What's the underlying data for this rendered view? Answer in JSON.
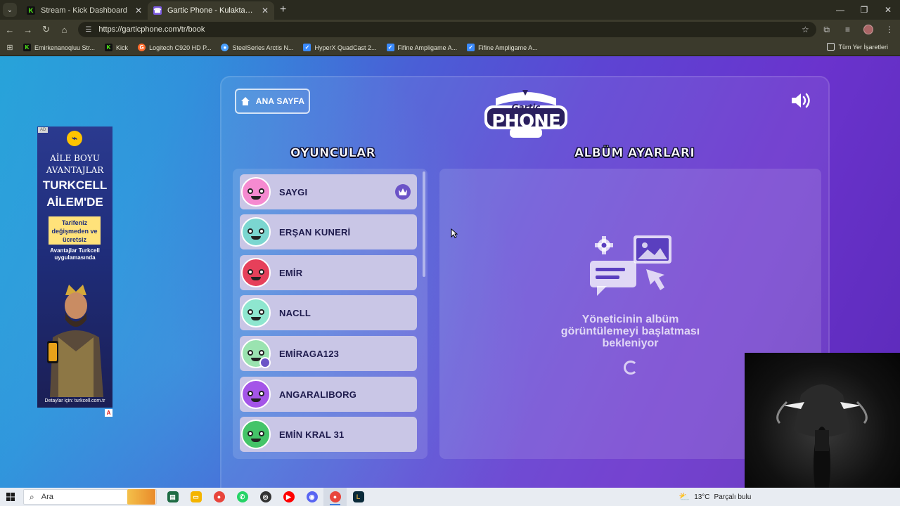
{
  "browser": {
    "tabs": [
      {
        "title": "Stream - Kick Dashboard",
        "favicon": "kick-icon",
        "color": "#53fc18",
        "active": false
      },
      {
        "title": "Gartic Phone - Kulaktan Kulağa",
        "favicon": "gartic-icon",
        "color": "#7b5ae0",
        "active": true
      }
    ],
    "url": "https://garticphone.com/tr/book",
    "bookmarks": [
      {
        "label": "Emirkenanoqluu Str...",
        "icon": "kick-icon",
        "color": "#53fc18"
      },
      {
        "label": "Kick",
        "icon": "kick-icon",
        "color": "#53fc18"
      },
      {
        "label": "Logitech C920 HD P...",
        "icon": "logitech-icon",
        "color": "#ff6b2b"
      },
      {
        "label": "SteelSeries Arctis N...",
        "icon": "steelseries-icon",
        "color": "#4aa0ff"
      },
      {
        "label": "HyperX QuadCast 2...",
        "icon": "hyperx-icon",
        "color": "#3a8bff"
      },
      {
        "label": "Fifine Ampligame A...",
        "icon": "fifine-icon",
        "color": "#3a8bff"
      },
      {
        "label": "Fifine Ampligame A...",
        "icon": "fifine-icon",
        "color": "#3a8bff"
      }
    ],
    "all_bookmarks": "Tüm Yer İşaretleri"
  },
  "ad": {
    "tag": "AD",
    "line1": "AİLE BOYU",
    "line2": "AVANTAJLAR",
    "big1": "TURKCELL",
    "big2": "AİLEM'DE",
    "box": "Tarifeniz değişmeden ve ücretsiz",
    "small": "Avantajlar Turkcell uygulamasında",
    "footer": "Detaylar için: turkcell.com.tr",
    "brand_color": "#ffc400"
  },
  "game": {
    "home_button": "ANA SAYFA",
    "logo_top": "Gartic",
    "logo_main": "PHONE",
    "players_title": "OYUNCULAR",
    "album_title": "ALBÜM AYARLARI",
    "players": [
      {
        "name": "SAYGI",
        "avatar": "pink-monster-avatar",
        "color": "#f58ad0",
        "host": true
      },
      {
        "name": "ERŞAN KUNERİ",
        "avatar": "skull-face-avatar",
        "color": "#7bd6d0",
        "host": false
      },
      {
        "name": "EMİR",
        "avatar": "red-demon-avatar",
        "color": "#e6405a",
        "host": false
      },
      {
        "name": "NACLL",
        "avatar": "mint-ghost-avatar",
        "color": "#8ee6cf",
        "host": false
      },
      {
        "name": "EMİRAGA123",
        "avatar": "panda-avatar",
        "color": "#9ae3b0",
        "host": false
      },
      {
        "name": "ANGARALIBORG",
        "avatar": "purple-ghost-avatar",
        "color": "#a455e8",
        "host": false
      },
      {
        "name": "EMİN KRAL 31",
        "avatar": "green-goblin-avatar",
        "color": "#44c468",
        "host": false
      }
    ],
    "waiting_text_1": "Yöneticinin albüm",
    "waiting_text_2": "görüntülemeyi başlatması",
    "waiting_text_3": "bekleniyor"
  },
  "taskbar": {
    "search_placeholder": "Ara",
    "apps": [
      {
        "name": "file-explorer-icon",
        "color": "#f4b400"
      },
      {
        "name": "chrome-icon",
        "color": "#e8453c"
      },
      {
        "name": "whatsapp-icon",
        "color": "#25d366"
      },
      {
        "name": "obs-icon",
        "color": "#333333"
      },
      {
        "name": "youtube-icon",
        "color": "#ff0000"
      },
      {
        "name": "discord-icon",
        "color": "#5865f2"
      },
      {
        "name": "chrome-icon",
        "color": "#e8453c"
      },
      {
        "name": "lol-icon",
        "color": "#c89b3c"
      }
    ],
    "temperature": "13°C",
    "weather": "Parçalı bulu"
  }
}
